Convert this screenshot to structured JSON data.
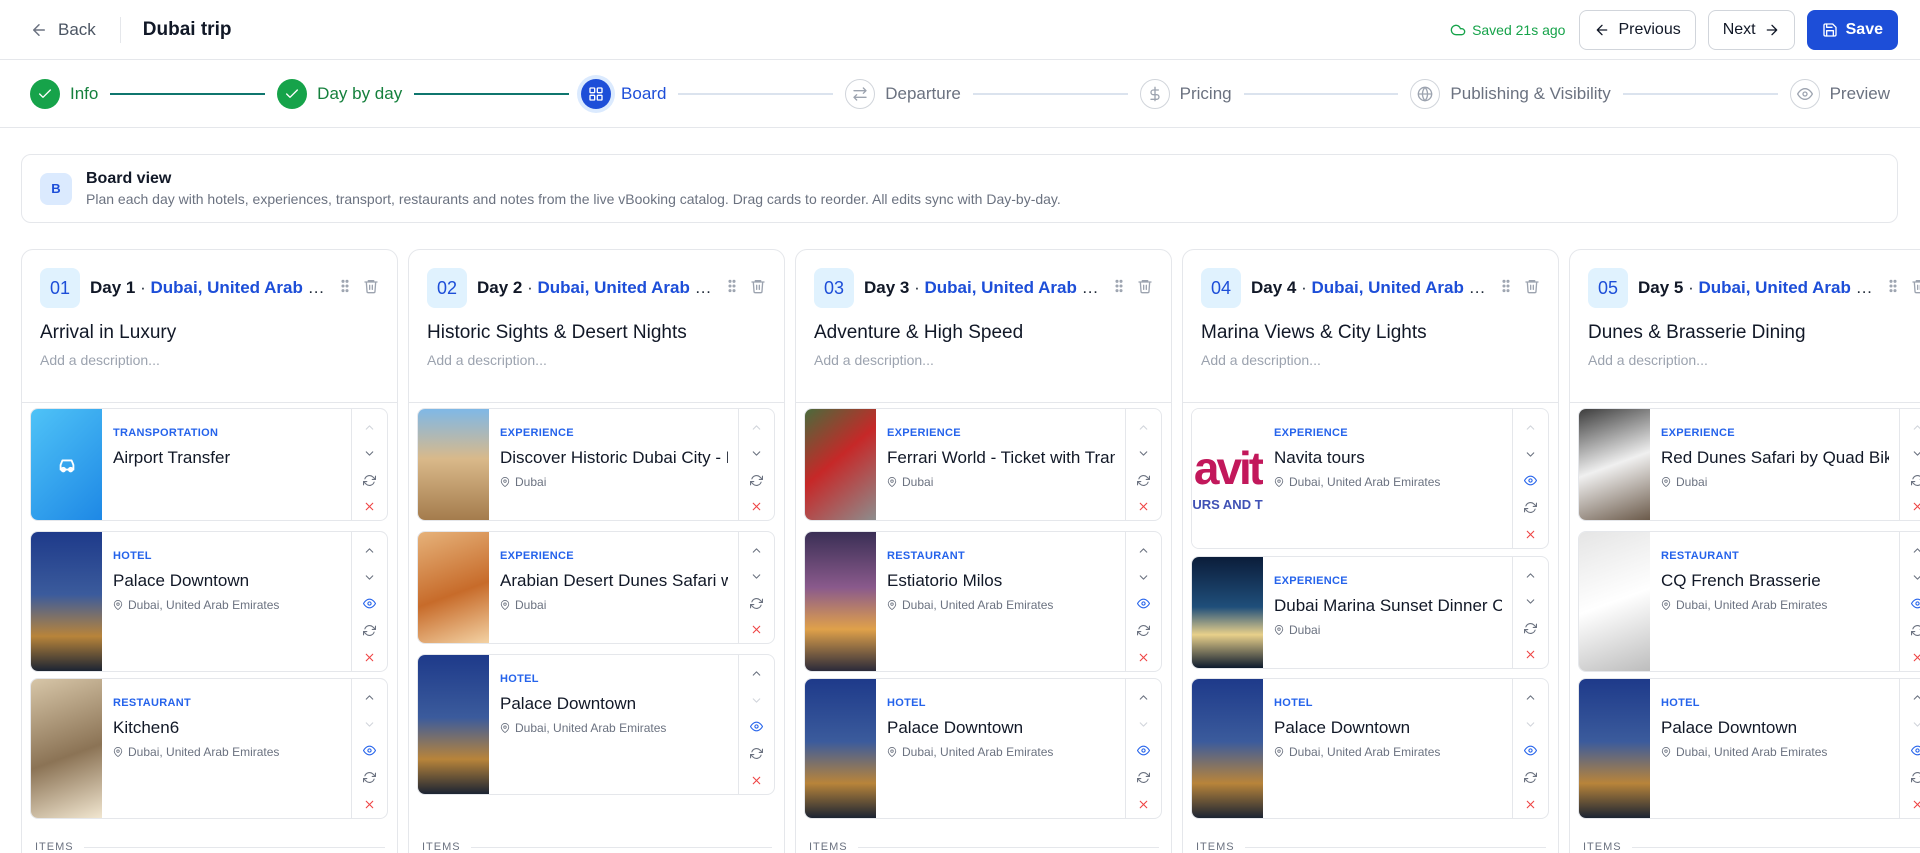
{
  "header": {
    "back_label": "Back",
    "title": "Dubai trip",
    "saved_text": "Saved 21s ago",
    "previous_label": "Previous",
    "next_label": "Next",
    "save_label": "Save"
  },
  "steps": [
    {
      "label": "Info",
      "state": "done"
    },
    {
      "label": "Day by day",
      "state": "done"
    },
    {
      "label": "Board",
      "state": "current"
    },
    {
      "label": "Departure",
      "state": "pending"
    },
    {
      "label": "Pricing",
      "state": "pending"
    },
    {
      "label": "Publishing & Visibility",
      "state": "pending"
    },
    {
      "label": "Preview",
      "state": "pending"
    }
  ],
  "banner": {
    "badge": "B",
    "title": "Board view",
    "description": "Plan each day with hotels, experiences, transport, restaurants and notes from the live vBooking catalog. Drag cards to reorder. All edits sync with Day-by-day."
  },
  "colors": {
    "accent": "#1d4ed8",
    "success": "#16a34a",
    "danger": "#ef4444"
  },
  "items_label": "ITEMS",
  "days": [
    {
      "num": "01",
      "day": "Day 1",
      "separator": " · ",
      "location": "Dubai, United Arab Emirates",
      "title": "Arrival in Luxury",
      "description": "Add a description...",
      "cards": [
        {
          "type": "TRANSPORTATION",
          "name": "Airport Transfer",
          "location": "",
          "image": "transport"
        },
        {
          "type": "HOTEL",
          "name": "Palace Downtown",
          "location": "Dubai, United Arab Emirates",
          "image": "city-night"
        },
        {
          "type": "RESTAURANT",
          "name": "Kitchen6",
          "location": "Dubai, United Arab Emirates",
          "image": "interior"
        }
      ]
    },
    {
      "num": "02",
      "day": "Day 2",
      "separator": " · ",
      "location": "Dubai, United Arab Emirates",
      "title": "Historic Sights & Desert Nights",
      "description": "Add a description...",
      "cards": [
        {
          "type": "EXPERIENCE",
          "name": "Discover Historic Dubai City - Private Tour",
          "location": "Dubai",
          "image": "old-city"
        },
        {
          "type": "EXPERIENCE",
          "name": "Arabian Desert Dunes Safari with BBQ",
          "location": "Dubai",
          "image": "desert"
        },
        {
          "type": "HOTEL",
          "name": "Palace Downtown",
          "location": "Dubai, United Arab Emirates",
          "image": "city-night"
        }
      ]
    },
    {
      "num": "03",
      "day": "Day 3",
      "separator": " · ",
      "location": "Dubai, United Arab Emirates",
      "title": "Adventure & High Speed",
      "description": "Add a description...",
      "cards": [
        {
          "type": "EXPERIENCE",
          "name": "Ferrari World - Ticket with Transfer",
          "location": "Dubai",
          "image": "ferrari"
        },
        {
          "type": "RESTAURANT",
          "name": "Estiatorio Milos",
          "location": "Dubai, United Arab Emirates",
          "image": "waterfront"
        },
        {
          "type": "HOTEL",
          "name": "Palace Downtown",
          "location": "Dubai, United Arab Emirates",
          "image": "city-night"
        }
      ]
    },
    {
      "num": "04",
      "day": "Day 4",
      "separator": " · ",
      "location": "Dubai, United Arab Emirates",
      "title": "Marina Views & City Lights",
      "description": "Add a description...",
      "cards": [
        {
          "type": "EXPERIENCE",
          "name": "Navita tours",
          "location": "Dubai, United Arab Emirates",
          "image": "logo",
          "logo_text": "avit",
          "logo_sub": "URS AND T"
        },
        {
          "type": "EXPERIENCE",
          "name": "Dubai Marina Sunset Dinner Cruise",
          "location": "Dubai",
          "image": "cruise"
        },
        {
          "type": "HOTEL",
          "name": "Palace Downtown",
          "location": "Dubai, United Arab Emirates",
          "image": "city-night"
        }
      ]
    },
    {
      "num": "05",
      "day": "Day 5",
      "separator": " · ",
      "location": "Dubai, United Arab Emirates",
      "title": "Dunes & Brasserie Dining",
      "description": "Add a description...",
      "cards": [
        {
          "type": "EXPERIENCE",
          "name": "Red Dunes Safari by Quad Bike",
          "location": "Dubai",
          "image": "people"
        },
        {
          "type": "RESTAURANT",
          "name": "CQ French Brasserie",
          "location": "Dubai, United Arab Emirates",
          "image": "plate"
        },
        {
          "type": "HOTEL",
          "name": "Palace Downtown",
          "location": "Dubai, United Arab Emirates",
          "image": "city-night"
        }
      ]
    }
  ]
}
